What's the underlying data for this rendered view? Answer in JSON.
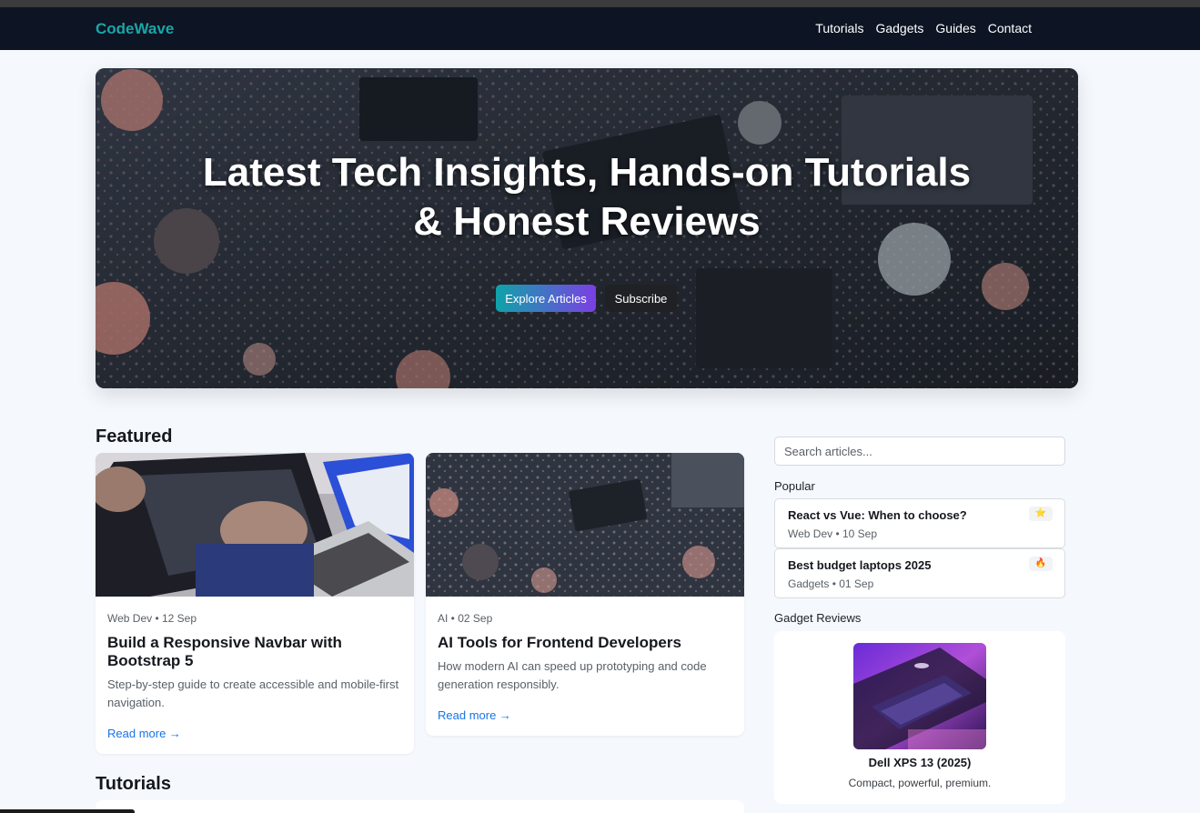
{
  "nav": {
    "brand": "CodeWave",
    "links": [
      "Tutorials",
      "Gadgets",
      "Guides",
      "Contact"
    ]
  },
  "hero": {
    "title_line1": "Latest Tech Insights, Hands-on Tutorials",
    "title_line2": "& Honest Reviews",
    "primary_button": "Explore Articles",
    "secondary_button": "Subscribe"
  },
  "featured": {
    "heading": "Featured",
    "articles": [
      {
        "meta": "Web Dev • 12 Sep",
        "title": "Build a Responsive Navbar with Bootstrap 5",
        "desc": "Step-by-step guide to create accessible and mobile-first navigation.",
        "link": "Read more →"
      },
      {
        "meta": "AI • 02 Sep",
        "title": "AI Tools for Frontend Developers",
        "desc": "How modern AI can speed up prototyping and code generation responsibly.",
        "link": "Read more →"
      }
    ]
  },
  "tutorials": {
    "heading": "Tutorials"
  },
  "sidebar": {
    "search_placeholder": "Search articles...",
    "popular_heading": "Popular",
    "popular": [
      {
        "title": "React vs Vue: When to choose?",
        "meta": "Web Dev • 10 Sep",
        "badge": "⭐"
      },
      {
        "title": "Best budget laptops 2025",
        "meta": "Gadgets • 01 Sep",
        "badge": "🔥"
      }
    ],
    "gadget_heading": "Gadget Reviews",
    "gadget": {
      "name": "Dell XPS 13 (2025)",
      "desc": "Compact, powerful, premium."
    }
  },
  "colors": {
    "navbar": "#0d1424",
    "brand": "#1aa6a6",
    "link": "#1a73e8",
    "gradient_start": "#0fa3a8",
    "gradient_end": "#7b3fe4"
  }
}
